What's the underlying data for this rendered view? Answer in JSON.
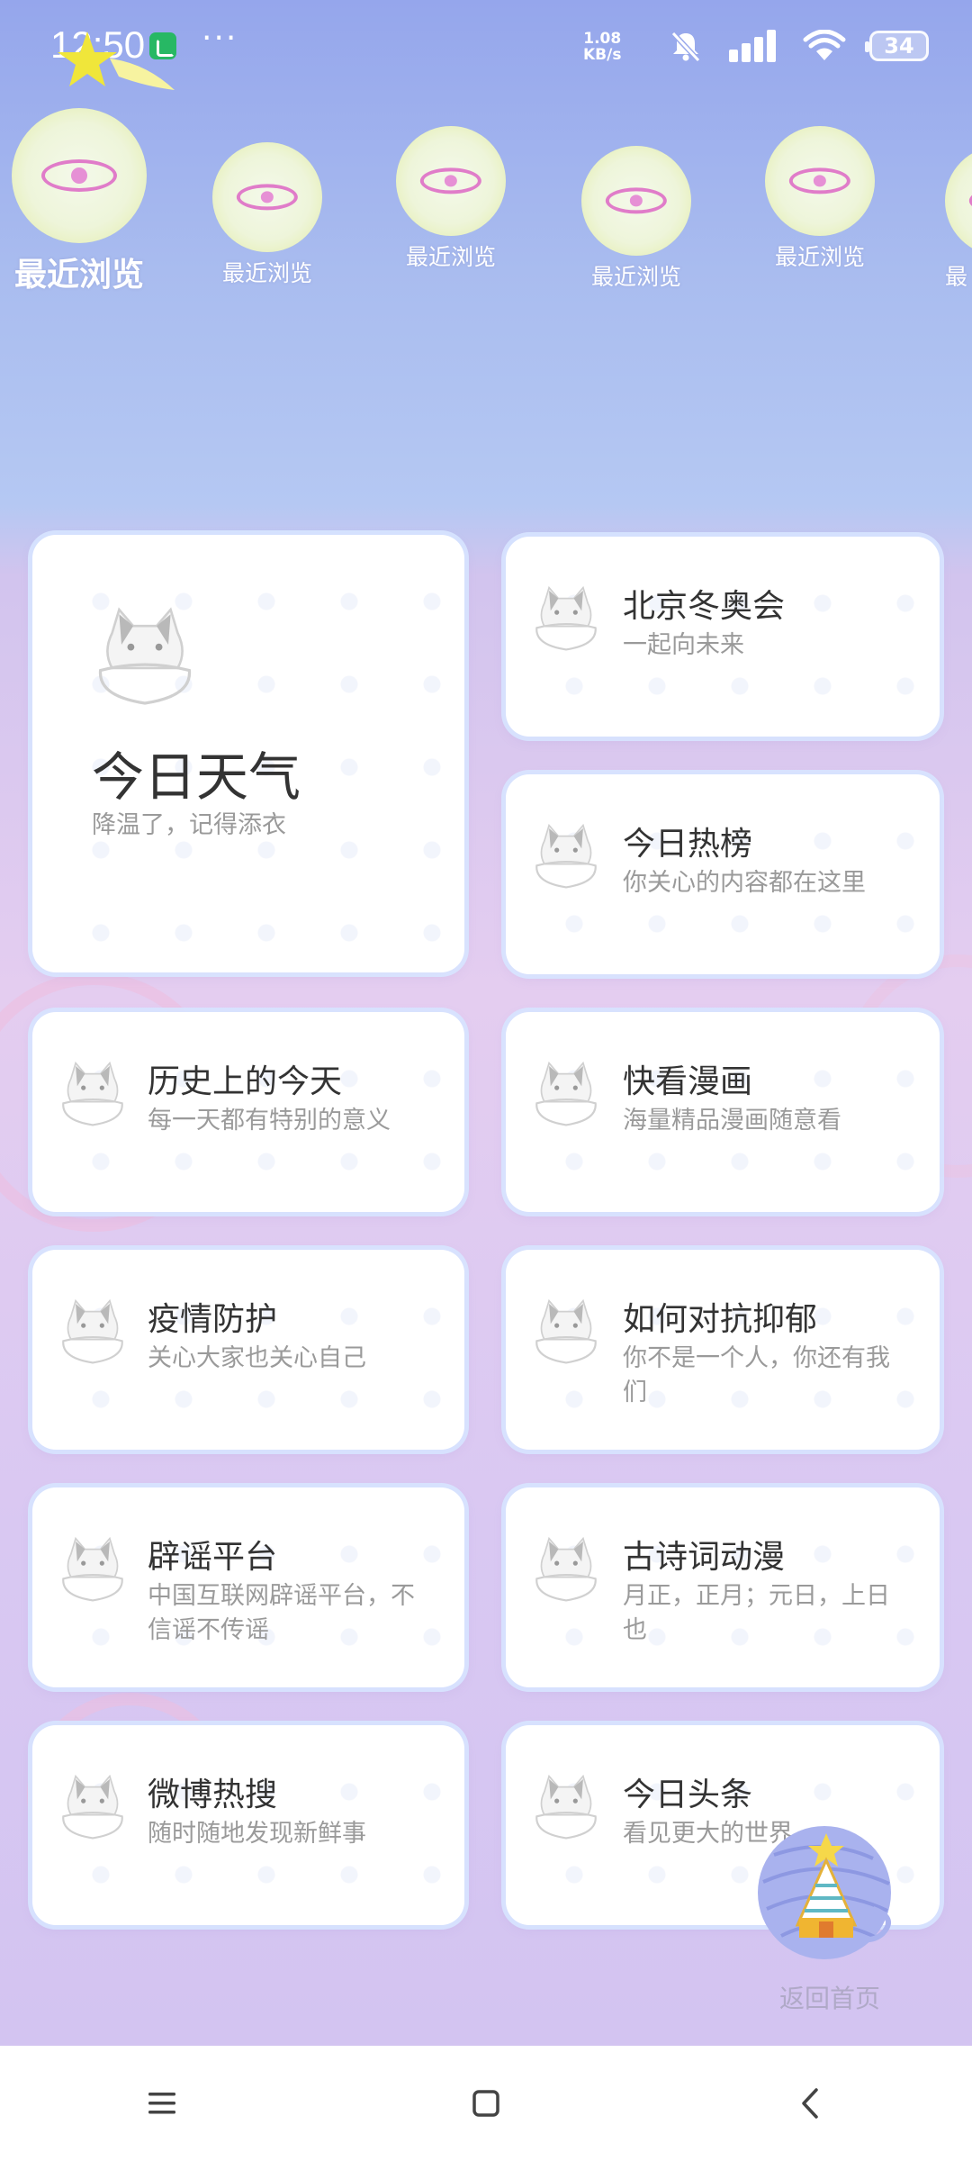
{
  "status_bar": {
    "time": "12:50",
    "net_speed_value": "1.08",
    "net_speed_unit": "KB/s",
    "battery": "34"
  },
  "recent": {
    "items": [
      {
        "label": "最近浏览"
      },
      {
        "label": "最近浏览"
      },
      {
        "label": "最近浏览"
      },
      {
        "label": "最近浏览"
      },
      {
        "label": "最近浏览"
      },
      {
        "label": "最"
      }
    ]
  },
  "cards": {
    "weather": {
      "title": "今日天气",
      "subtitle": "降温了，记得添衣"
    },
    "olympics": {
      "title": "北京冬奥会",
      "subtitle": "一起向未来"
    },
    "hot_list": {
      "title": "今日热榜",
      "subtitle": "你关心的内容都在这里"
    },
    "history": {
      "title": "历史上的今天",
      "subtitle": "每一天都有特别的意义"
    },
    "comics": {
      "title": "快看漫画",
      "subtitle": "海量精品漫画随意看"
    },
    "epidemic": {
      "title": "疫情防护",
      "subtitle": "关心大家也关心自己"
    },
    "depression": {
      "title": "如何对抗抑郁",
      "subtitle": "你不是一个人，你还有我们"
    },
    "rumor": {
      "title": "辟谣平台",
      "subtitle": "中国互联网辟谣平台，不信谣不传谣"
    },
    "poetry": {
      "title": "古诗词动漫",
      "subtitle": "月正，正月；元日，上日也"
    },
    "weibo": {
      "title": "微博热搜",
      "subtitle": "随时随地发现新鲜事"
    },
    "toutiao": {
      "title": "今日头条",
      "subtitle": "看见更大的世界"
    }
  },
  "return_home": {
    "label": "返回首页"
  },
  "icons": {
    "recent": "eye-ball-icon",
    "card": "cat-icon",
    "return": "yarn-tent-icon",
    "nav": [
      "menu-icon",
      "home-icon",
      "back-icon"
    ]
  },
  "colors": {
    "top_gradient": "#95a6ec",
    "bottom_gradient": "#d9c8f2",
    "accent_yellow": "#e9f14e",
    "eye_pink": "#e07cc9"
  }
}
